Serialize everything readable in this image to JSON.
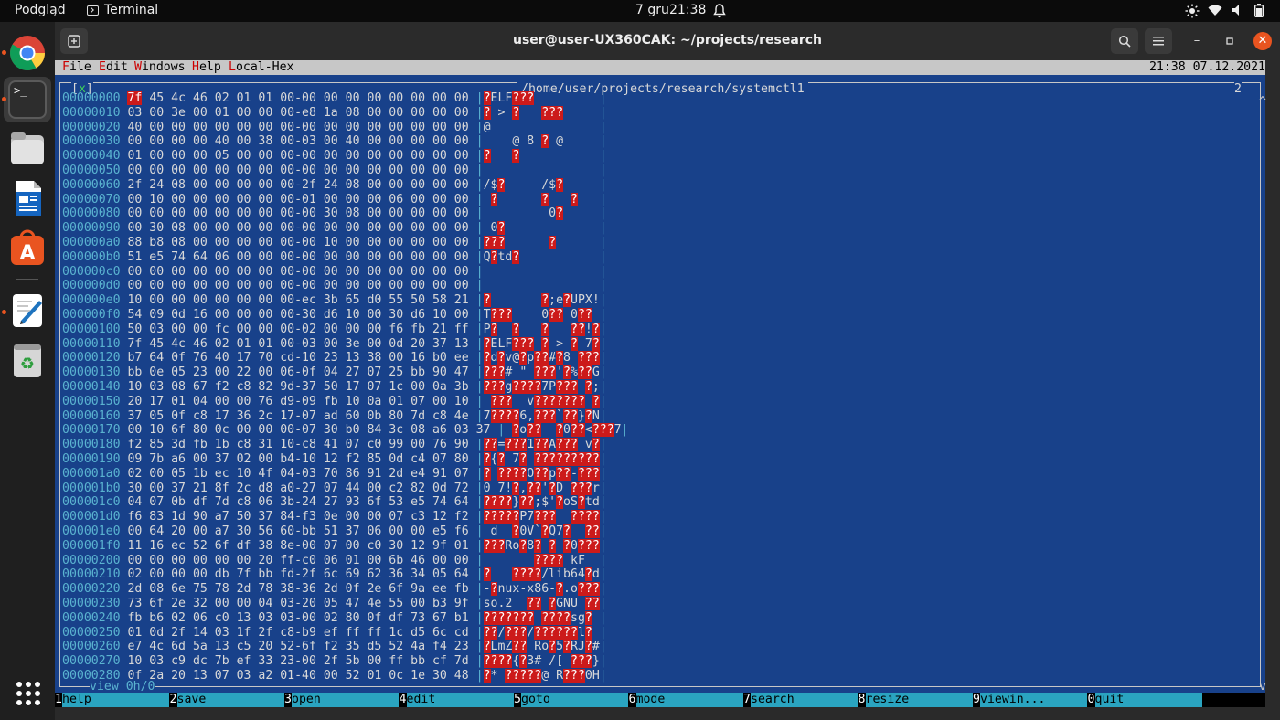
{
  "topbar": {
    "activities": "Podgląd",
    "app_name": "Terminal",
    "date": "7 gru",
    "time": "21:38"
  },
  "window": {
    "title": "user@user-UX360CAK: ~/projects/research"
  },
  "menubar": {
    "items": [
      "File",
      "Edit",
      "Windows",
      "Help",
      "Local-Hex"
    ],
    "clock": "21:38 07.12.2021"
  },
  "frame": {
    "close_mark": "[x]",
    "path": "/home/user/projects/research/systemctl1",
    "window_number": "2",
    "view_info": "view 0h/0"
  },
  "hex_rows": [
    {
      "off": "00000000",
      "hex": "7f 45 4c 46 02 01 01 00-00 00 00 00 00 00 00 00",
      "asc": "?ELF???",
      "hl_first": true
    },
    {
      "off": "00000010",
      "hex": "03 00 3e 00 01 00 00 00-e8 1a 08 00 00 00 00 00",
      "asc": "? > ?   ???"
    },
    {
      "off": "00000020",
      "hex": "40 00 00 00 00 00 00 00-00 00 00 00 00 00 00 00",
      "asc": "@"
    },
    {
      "off": "00000030",
      "hex": "00 00 00 00 40 00 38 00-03 00 40 00 00 00 00 00",
      "asc": "    @ 8 ? @"
    },
    {
      "off": "00000040",
      "hex": "01 00 00 00 05 00 00 00-00 00 00 00 00 00 00 00",
      "asc": "?   ?"
    },
    {
      "off": "00000050",
      "hex": "00 00 00 00 00 00 00 00-00 00 00 00 00 00 00 00",
      "asc": ""
    },
    {
      "off": "00000060",
      "hex": "2f 24 08 00 00 00 00 00-2f 24 08 00 00 00 00 00",
      "asc": "/$?     /$?"
    },
    {
      "off": "00000070",
      "hex": "00 10 00 00 00 00 00 00-01 00 00 00 06 00 00 00",
      "asc": " ?      ?   ?"
    },
    {
      "off": "00000080",
      "hex": "00 00 00 00 00 00 00 00-00 30 08 00 00 00 00 00",
      "asc": "         0?"
    },
    {
      "off": "00000090",
      "hex": "00 30 08 00 00 00 00 00-00 00 00 00 00 00 00 00",
      "asc": " 0?"
    },
    {
      "off": "000000a0",
      "hex": "88 b8 08 00 00 00 00 00-00 10 00 00 00 00 00 00",
      "asc": "???      ?"
    },
    {
      "off": "000000b0",
      "hex": "51 e5 74 64 06 00 00 00-00 00 00 00 00 00 00 00",
      "asc": "Q?td?"
    },
    {
      "off": "000000c0",
      "hex": "00 00 00 00 00 00 00 00-00 00 00 00 00 00 00 00",
      "asc": ""
    },
    {
      "off": "000000d0",
      "hex": "00 00 00 00 00 00 00 00-00 00 00 00 00 00 00 00",
      "asc": ""
    },
    {
      "off": "000000e0",
      "hex": "10 00 00 00 00 00 00 00-ec 3b 65 d0 55 50 58 21",
      "asc": "?       ?;e?UPX!"
    },
    {
      "off": "000000f0",
      "hex": "54 09 0d 16 00 00 00 00-30 d6 10 00 30 d6 10 00",
      "asc": "T???    0?? 0??"
    },
    {
      "off": "00000100",
      "hex": "50 03 00 00 fc 00 00 00-02 00 00 00 f6 fb 21 ff",
      "asc": "P?  ?   ?   ??!?"
    },
    {
      "off": "00000110",
      "hex": "7f 45 4c 46 02 01 01 00-03 00 3e 00 0d 20 37 13",
      "asc": "?ELF??? ? > ? 7?"
    },
    {
      "off": "00000120",
      "hex": "b7 64 0f 76 40 17 70 cd-10 23 13 38 00 16 b0 ee",
      "asc": "?d?v@?p??#?8 ???"
    },
    {
      "off": "00000130",
      "hex": "bb 0e 05 23 00 22 00 06-0f 04 27 07 25 bb 90 47",
      "asc": "???# \" ???'?%??G"
    },
    {
      "off": "00000140",
      "hex": "10 03 08 67 f2 c8 82 9d-37 50 17 07 1c 00 0a 3b",
      "asc": "???g????7P??? ?;"
    },
    {
      "off": "00000150",
      "hex": "20 17 01 04 00 00 76 d9-09 fb 10 0a 01 07 00 10",
      "asc": " ???  v??????? ?"
    },
    {
      "off": "00000160",
      "hex": "37 05 0f c8 17 36 2c 17-07 ad 60 0b 80 7d c8 4e",
      "asc": "7????6,???`??}?N"
    },
    {
      "off": "00000170",
      "hex": "00 10 6f 80 0c 00 00 00-07 30 b0 84 3c 08 a6 03 37",
      "asc": " ?o??  ?0??<???7"
    },
    {
      "off": "00000180",
      "hex": "f2 85 3d fb 1b c8 31 10-c8 41 07 c0 99 00 76 90",
      "asc": "??=???1??A??? v?"
    },
    {
      "off": "00000190",
      "hex": "09 7b a6 00 37 02 00 b4-10 12 f2 85 0d c4 07 80",
      "asc": "?{? 7? ?????????"
    },
    {
      "off": "000001a0",
      "hex": "02 00 05 1b ec 10 4f 04-03 70 86 91 2d e4 91 07",
      "asc": "? ????O??p??-???"
    },
    {
      "off": "000001b0",
      "hex": "30 00 37 21 8f 2c d8 a0-27 07 44 00 c2 82 0d 72",
      "asc": "0 7!?,??'?D ???r"
    },
    {
      "off": "000001c0",
      "hex": "04 07 0b df 7d c8 06 3b-24 27 93 6f 53 e5 74 64",
      "asc": "????}??;$'?oS?td"
    },
    {
      "off": "000001d0",
      "hex": "f6 83 1d 90 a7 50 37 84-f3 0e 00 00 07 c3 12 f2",
      "asc": "?????P7???  ????"
    },
    {
      "off": "000001e0",
      "hex": "00 64 20 00 a7 30 56 60-bb 51 37 06 00 00 e5 f6",
      "asc": " d  ?0V`?Q7?  ??"
    },
    {
      "off": "000001f0",
      "hex": "11 16 ec 52 6f df 38 8e-00 07 00 c0 30 12 9f 01",
      "asc": "???Ro?8? ? ?0???"
    },
    {
      "off": "00000200",
      "hex": "00 00 00 00 00 00 20 ff-c0 06 01 00 6b 46 00 00",
      "asc": "       ???? kF"
    },
    {
      "off": "00000210",
      "hex": "02 00 00 00 db 7f bb fd-2f 6c 69 62 36 34 05 64",
      "asc": "?   ????/lib64?d"
    },
    {
      "off": "00000220",
      "hex": "2d 08 6e 75 78 2d 78 38-36 2d 0f 2e 6f 9a ee fb",
      "asc": "-?nux-x86-?.o???"
    },
    {
      "off": "00000230",
      "hex": "73 6f 2e 32 00 00 04 03-20 05 47 4e 55 00 b3 9f",
      "asc": "so.2  ?? ?GNU ??"
    },
    {
      "off": "00000240",
      "hex": "fb b6 02 06 c0 13 03 03-00 02 80 0f df 73 67 b1",
      "asc": "??????? ????sg?"
    },
    {
      "off": "00000250",
      "hex": "01 0d 2f 14 03 1f 2f c8-b9 ef ff ff 1c d5 6c cd",
      "asc": "??/???/??????l?"
    },
    {
      "off": "00000260",
      "hex": "e7 4c 6d 5a 13 c5 20 52-6f f2 35 d5 52 4a f4 23",
      "asc": "?LmZ?? Ro?5?RJ?#"
    },
    {
      "off": "00000270",
      "hex": "10 03 c9 dc 7b ef 33 23-00 2f 5b 00 ff bb cf 7d",
      "asc": "????{?3# /[ ???}"
    },
    {
      "off": "00000280",
      "hex": "0f 2a 20 13 07 03 a2 01-40 00 52 01 0c 1e 30 48",
      "asc": "?* ?????@ R???0H"
    }
  ],
  "fkeys": [
    {
      "n": "1",
      "label": "help"
    },
    {
      "n": "2",
      "label": "save"
    },
    {
      "n": "3",
      "label": "open"
    },
    {
      "n": "4",
      "label": "edit"
    },
    {
      "n": "5",
      "label": "goto"
    },
    {
      "n": "6",
      "label": "mode"
    },
    {
      "n": "7",
      "label": "search"
    },
    {
      "n": "8",
      "label": "resize"
    },
    {
      "n": "9",
      "label": "viewin..."
    },
    {
      "n": "0",
      "label": "quit"
    }
  ],
  "colors": {
    "panel_bg": "#18418a",
    "offset": "#5ab3d0",
    "highlight": "#cc1a1a",
    "fkey_bg": "#2aa4c0",
    "dock_active_dot": "#e95420"
  }
}
